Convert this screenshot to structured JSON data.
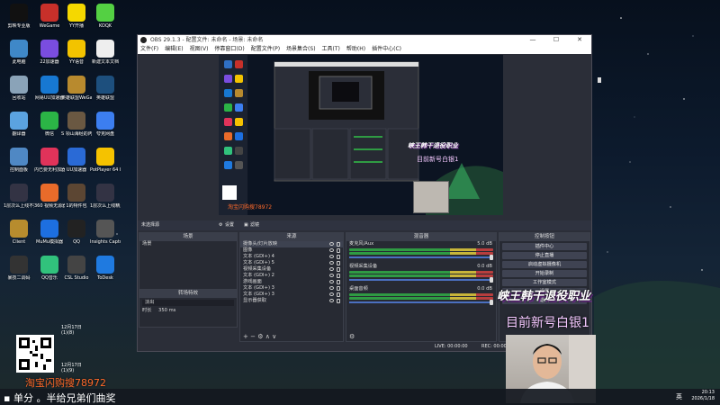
{
  "desktop": {
    "icons": [
      {
        "label": "剪映专业版",
        "color": "#111"
      },
      {
        "label": "WeGame",
        "color": "#c7302a"
      },
      {
        "label": "YY开播",
        "color": "#f5d800"
      },
      {
        "label": "KOOK",
        "color": "#54d043"
      },
      {
        "label": "此电脑",
        "color": "#3f88c8"
      },
      {
        "label": "22加速器",
        "color": "#7a4de0"
      },
      {
        "label": "YY语音",
        "color": "#f3c300"
      },
      {
        "label": "新建文本文档",
        "color": "#eeeeee"
      },
      {
        "label": "回收站",
        "color": "#8aa3b8"
      },
      {
        "label": "网易UU加速器",
        "color": "#1778d2"
      },
      {
        "label": "英雄联盟WeGame版",
        "color": "#b88a2e"
      },
      {
        "label": "英雄联盟",
        "color": "#1d4f7d"
      },
      {
        "label": "翻译器",
        "color": "#5ba3e0"
      },
      {
        "label": "微信",
        "color": "#2bb446"
      },
      {
        "label": "S 领山海经的丙后赛下",
        "color": "#6a5842"
      },
      {
        "label": "夸克网盘",
        "color": "#3c7ef0"
      },
      {
        "label": "控制面板",
        "color": "#4f88c4"
      },
      {
        "label": "内已要无利加器",
        "color": "#e0335a"
      },
      {
        "label": "UU加速器",
        "color": "#2a6ad6"
      },
      {
        "label": "PotPlayer 64 bit",
        "color": "#f5c200"
      },
      {
        "label": "1层次么上线不授源",
        "color": "#334"
      },
      {
        "label": "360 视频无源器1",
        "color": "#e96b2a"
      },
      {
        "label": "1的特件包",
        "color": "#5c4633"
      },
      {
        "label": "1层次么上线精灵",
        "color": "#334"
      },
      {
        "label": "Client",
        "color": "#b78c2e"
      },
      {
        "label": "MuMu模拟器",
        "color": "#1d6fe0"
      },
      {
        "label": "QQ",
        "color": "#222"
      },
      {
        "label": "Insights Capture",
        "color": "#555"
      },
      {
        "label": "暴技二调码",
        "color": "#333"
      },
      {
        "label": "QQ音乐",
        "color": "#31c27c"
      },
      {
        "label": "CSL Studio",
        "color": "#444"
      },
      {
        "label": "ToDesk",
        "color": "#1f7ae0"
      }
    ],
    "dates": [
      "12月17日 (1)(8)",
      "12月17日 (1)(9)"
    ]
  },
  "obs": {
    "title": "OBS 29.1.3 - 配置文件: 未命名 - 场景: 未命名",
    "menu": [
      "文件(F)",
      "编辑(E)",
      "视图(V)",
      "停靠窗口(D)",
      "配置文件(P)",
      "场景集合(S)",
      "工具(T)",
      "帮助(H)",
      "插件中心(C)"
    ],
    "win_buttons": [
      "—",
      "☐",
      "✕"
    ],
    "dock_bar": {
      "left": "未选择源",
      "gear": "设置",
      "filter": "滤镜"
    },
    "scenes": {
      "header": "场景",
      "items": [
        "场景"
      ]
    },
    "sources": {
      "header": "来源",
      "items": [
        "摄像头/灯片放映",
        "图像",
        "文本 (GDI+) 4",
        "文本 (GDI+) 5",
        "视频采集设备",
        "文本 (GDI+) 2",
        "游戏画面",
        "文本 (GDI+) 3",
        "文本 (GDI+) 3",
        "显示器获取"
      ]
    },
    "transition": {
      "header": "转场特效",
      "value": "淡出",
      "duration_label": "时长",
      "duration": "350 ms"
    },
    "mixer": {
      "header": "混音器",
      "channels": [
        {
          "name": "麦克风/Aux",
          "db": "5.0 dB"
        },
        {
          "name": "视频采集设备",
          "db": "0.0 dB"
        },
        {
          "name": "桌面音频",
          "db": "0.0 dB"
        }
      ]
    },
    "controls": {
      "header": "控制按钮",
      "buttons": [
        "插件中心",
        "停止直播",
        "启动虚拟摄像机",
        "开始录制",
        "工作室模式",
        "设置",
        "退出"
      ]
    },
    "status": {
      "live": "LIVE: 00:00:00",
      "rec": "REC: 00:00:00"
    }
  },
  "overlay": {
    "title": "峡王韩干退役职业",
    "subtitle": "目前新号白银1",
    "taobao": "淘宝闪购搜78972",
    "ticker": "单分 。半给兄弟们曲奖"
  },
  "preview": {
    "mini_title": "峡王韩干退役职业",
    "mini_sub": "目前新号白银1",
    "mini_taobao": "淘宝闪购搜78972"
  },
  "taskbar": {
    "lang": "英",
    "time": "20:13",
    "date": "2026/1/18"
  }
}
